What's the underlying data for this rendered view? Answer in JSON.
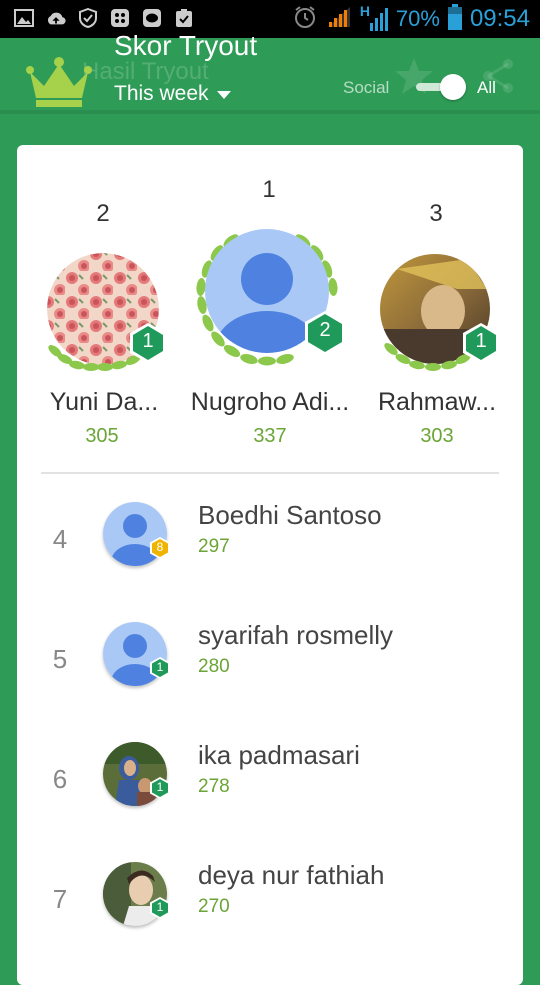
{
  "status_bar": {
    "battery_percent": "70%",
    "time": "09:54",
    "network": "H",
    "icons": [
      "gallery-icon",
      "cloud-upload-icon",
      "shield-icon",
      "bbm-icon",
      "line-icon",
      "clipboard-check-icon",
      "alarm-icon",
      "signal-icon",
      "network-signal-icon",
      "battery-icon"
    ]
  },
  "header": {
    "ghost_title": "Hasil Tryout",
    "title": "Skor Tryout",
    "period": "This week",
    "social_label": "Social",
    "all_label": "All",
    "toggle_on": true,
    "crown_color": "#a6d14a"
  },
  "podium": [
    {
      "rank": "2",
      "name": "Yuni Da...",
      "score": "305",
      "level": "1"
    },
    {
      "rank": "1",
      "name": "Nugroho Adi...",
      "score": "337",
      "level": "2"
    },
    {
      "rank": "3",
      "name": "Rahmaw...",
      "score": "303",
      "level": "1"
    }
  ],
  "list": [
    {
      "rank": "4",
      "name": "Boedhi Santoso",
      "score": "297",
      "level": "8"
    },
    {
      "rank": "5",
      "name": "syarifah rosmelly",
      "score": "280",
      "level": "1"
    },
    {
      "rank": "6",
      "name": "ika padmasari",
      "score": "278",
      "level": "1"
    },
    {
      "rank": "7",
      "name": "deya nur fathiah",
      "score": "270",
      "level": "1"
    }
  ],
  "colors": {
    "primary_green": "#2e9b57",
    "score_green": "#6aa536",
    "badge_green": "#1f9a5a",
    "badge_gold": "#f0b400",
    "avatar_blue": "#4f82e0"
  }
}
